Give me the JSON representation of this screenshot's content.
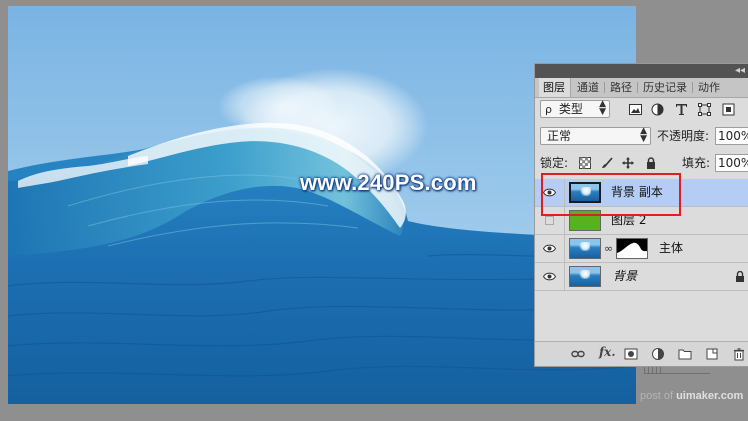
{
  "watermark": {
    "text": "www.240PS.com"
  },
  "corner_watermark": {
    "prefix": "post of ",
    "site": "uimaker.com"
  },
  "panel": {
    "tabs": [
      {
        "label": "图层",
        "active": true
      },
      {
        "label": "通道",
        "active": false
      },
      {
        "label": "路径",
        "active": false
      },
      {
        "label": "历史记录",
        "active": false
      },
      {
        "label": "动作",
        "active": false
      }
    ],
    "filter": {
      "search_glyph": "ρ",
      "value": "类型"
    },
    "blend_mode": "正常",
    "opacity": {
      "label": "不透明度:",
      "value": "100%"
    },
    "lock": {
      "label": "锁定:"
    },
    "fill": {
      "label": "填充:",
      "value": "100%"
    },
    "layers": [
      {
        "name": "背景 副本",
        "visible": true,
        "selected": true,
        "thumb": "wave"
      },
      {
        "name": "图层 2",
        "visible": false,
        "selected": false,
        "thumb": "green"
      },
      {
        "name": "主体",
        "visible": true,
        "selected": false,
        "thumb": "wave",
        "has_mask": true
      },
      {
        "name": "背景",
        "visible": true,
        "selected": false,
        "thumb": "wave",
        "locked": true
      }
    ],
    "bottom": {
      "fx_label": "fx."
    }
  },
  "colors": {
    "selected_row": "#b5cdf5",
    "highlight_box": "#e01e24",
    "panel_bg": "#dcdcdc",
    "workspace": "#8f8f8f"
  }
}
